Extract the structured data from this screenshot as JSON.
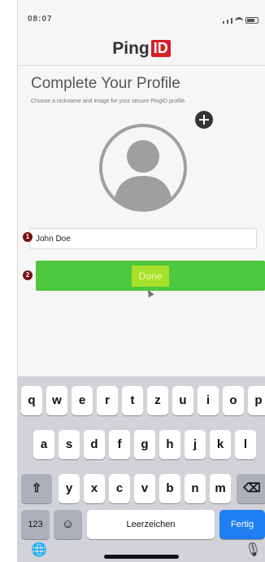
{
  "status_bar": {
    "time": "08:07"
  },
  "header": {
    "logo_text": "Ping",
    "logo_badge": "ID"
  },
  "profile": {
    "title": "Complete Your Profile",
    "subtitle": "Choose a nickname and image for your secure PingID profile."
  },
  "form": {
    "step1_badge": "1",
    "step2_badge": "2",
    "name_value": "John Doe",
    "done_label": "Done"
  },
  "keyboard": {
    "row1": [
      "q",
      "w",
      "e",
      "r",
      "t",
      "z",
      "u",
      "i",
      "o",
      "p"
    ],
    "row2": [
      "a",
      "s",
      "d",
      "f",
      "g",
      "h",
      "j",
      "k",
      "l"
    ],
    "row3": [
      "y",
      "x",
      "c",
      "v",
      "b",
      "n",
      "m"
    ],
    "numbers_label": "123",
    "space_label": "Leerzeichen",
    "return_label": "Fertig",
    "shift_glyph": "⇧",
    "delete_glyph": "⌫",
    "emoji_glyph": "☺",
    "globe_glyph": "🌐",
    "mic_glyph": "🎙"
  },
  "colors": {
    "accent_red": "#d42027",
    "done_green": "#4ec83e",
    "return_blue": "#1f7ef2"
  }
}
